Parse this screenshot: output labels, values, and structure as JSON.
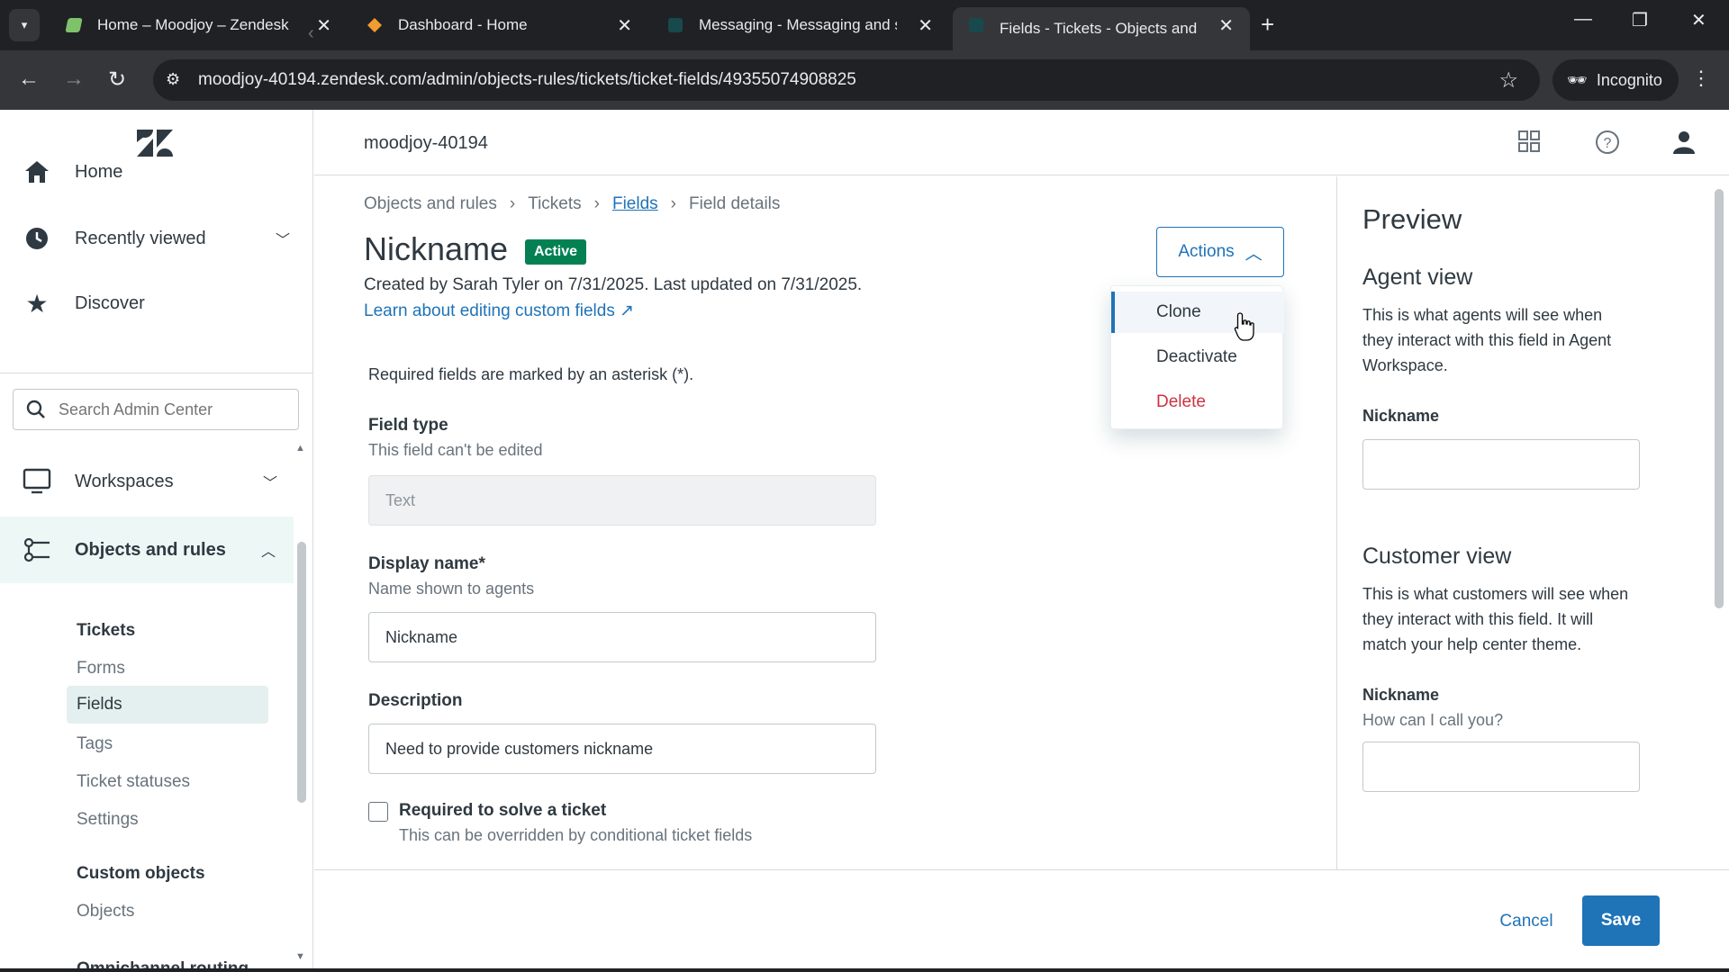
{
  "browser": {
    "tabs": [
      {
        "title": "Home – Moodjoy – Zendesk"
      },
      {
        "title": "Dashboard - Home"
      },
      {
        "title": "Messaging - Messaging and so"
      },
      {
        "title": "Fields - Tickets - Objects and ru"
      }
    ],
    "url": "moodjoy-40194.zendesk.com/admin/objects-rules/tickets/ticket-fields/49355074908825",
    "incognito_label": "Incognito"
  },
  "sidebar": {
    "nav": [
      {
        "label": "Home"
      },
      {
        "label": "Recently viewed"
      },
      {
        "label": "Discover"
      }
    ],
    "search_placeholder": "Search Admin Center",
    "sections": [
      {
        "label": "Workspaces"
      },
      {
        "label": "Objects and rules"
      }
    ],
    "tickets_heading": "Tickets",
    "ticket_items": [
      "Forms",
      "Fields",
      "Tags",
      "Ticket statuses",
      "Settings"
    ],
    "custom_objects_heading": "Custom objects",
    "custom_items": [
      "Objects"
    ],
    "next_heading": "Omnichannel routing"
  },
  "header": {
    "account": "moodjoy-40194"
  },
  "main": {
    "breadcrumbs": [
      "Objects and rules",
      "Tickets",
      "Fields",
      "Field details"
    ],
    "title": "Nickname",
    "status": "Active",
    "meta": "Created by Sarah Tyler on 7/31/2025. Last updated on 7/31/2025.",
    "learn_link": "Learn about editing custom fields",
    "actions_label": "Actions",
    "required_note": "Required fields are marked by an asterisk (*).",
    "field_type": {
      "label": "Field type",
      "hint": "This field can't be edited",
      "value": "Text"
    },
    "display_name": {
      "label": "Display name*",
      "hint": "Name shown to agents",
      "value": "Nickname"
    },
    "description": {
      "label": "Description",
      "value": "Need to provide customers nickname"
    },
    "required_checkbox": {
      "label": "Required to solve a ticket",
      "hint": "This can be overridden by conditional ticket fields"
    }
  },
  "actions_menu": {
    "items": [
      "Clone",
      "Deactivate",
      "Delete"
    ]
  },
  "preview": {
    "title": "Preview",
    "agent_heading": "Agent view",
    "agent_text": "This is what agents will see when they interact with this field in Agent Workspace.",
    "agent_field_label": "Nickname",
    "customer_heading": "Customer view",
    "customer_text": "This is what customers will see when they interact with this field. It will match your help center theme.",
    "customer_field_label": "Nickname",
    "customer_field_hint": "How can I call you?"
  },
  "footer": {
    "cancel": "Cancel",
    "save": "Save"
  },
  "colors": {
    "accent": "#1f73b7",
    "active_badge": "#038153",
    "danger": "#cc3340"
  }
}
